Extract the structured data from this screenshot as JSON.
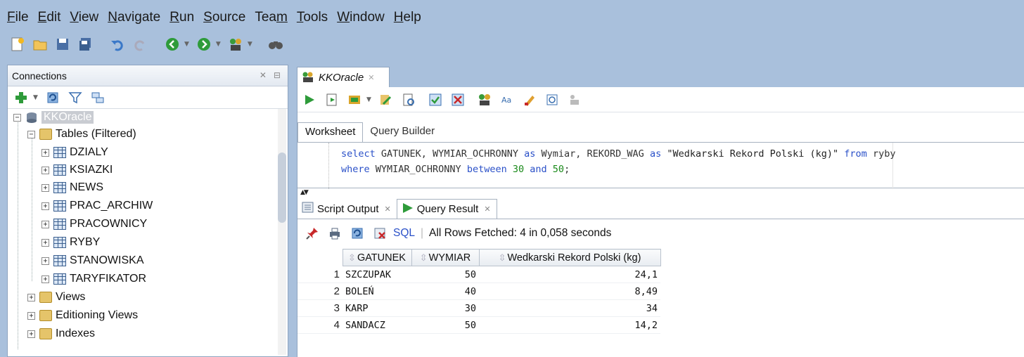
{
  "menu": [
    {
      "pre": "",
      "u": "F",
      "post": "ile"
    },
    {
      "pre": "",
      "u": "E",
      "post": "dit"
    },
    {
      "pre": "",
      "u": "V",
      "post": "iew"
    },
    {
      "pre": "",
      "u": "N",
      "post": "avigate"
    },
    {
      "pre": "",
      "u": "R",
      "post": "un"
    },
    {
      "pre": "",
      "u": "S",
      "post": "ource"
    },
    {
      "pre": "Tea",
      "u": "m",
      "post": ""
    },
    {
      "pre": "",
      "u": "T",
      "post": "ools"
    },
    {
      "pre": "",
      "u": "W",
      "post": "indow"
    },
    {
      "pre": "",
      "u": "H",
      "post": "elp"
    }
  ],
  "connections": {
    "title": "Connections",
    "tree": {
      "root": "KKOracle",
      "tables_folder": "Tables (Filtered)",
      "tables": [
        "DZIALY",
        "KSIAZKI",
        "NEWS",
        "PRAC_ARCHIW",
        "PRACOWNICY",
        "RYBY",
        "STANOWISKA",
        "TARYFIKATOR"
      ],
      "views": "Views",
      "editioning_views": "Editioning Views",
      "indexes": "Indexes"
    }
  },
  "editor": {
    "tab_title": "KKOracle",
    "subtabs": [
      "Worksheet",
      "Query Builder"
    ],
    "sql": {
      "line1": {
        "k1": "select",
        "t1": " GATUNEK, WYMIAR_OCHRONNY ",
        "k2": "as",
        "t2": " Wymiar, REKORD_WAG ",
        "k3": "as",
        "s1": " \"Wedkarski Rekord Polski (kg)\" ",
        "k4": "from",
        "t3": " ryby"
      },
      "line2": {
        "k1": "where",
        "t1": " WYMIAR_OCHRONNY ",
        "k2": "between",
        "n1": "30",
        "k3": "and",
        "n2": "50",
        "t2": ";"
      }
    }
  },
  "output": {
    "tabs": [
      "Script Output",
      "Query Result"
    ],
    "sql_link": "SQL",
    "status": "All Rows Fetched: 4 in 0,058 seconds",
    "columns": [
      "GATUNEK",
      "WYMIAR",
      "Wedkarski Rekord Polski (kg)"
    ],
    "rows": [
      {
        "n": "1",
        "gatunek": "SZCZUPAK",
        "wymiar": "50",
        "rekord": "24,1"
      },
      {
        "n": "2",
        "gatunek": "BOLEŃ",
        "wymiar": "40",
        "rekord": "8,49"
      },
      {
        "n": "3",
        "gatunek": "KARP",
        "wymiar": "30",
        "rekord": "34"
      },
      {
        "n": "4",
        "gatunek": "SANDACZ",
        "wymiar": "50",
        "rekord": "14,2"
      }
    ]
  },
  "colors": {
    "background": "#a9c0dc",
    "keyword": "#2a50c8",
    "number": "#1a8a1a",
    "selection": "#c9ccd2"
  }
}
